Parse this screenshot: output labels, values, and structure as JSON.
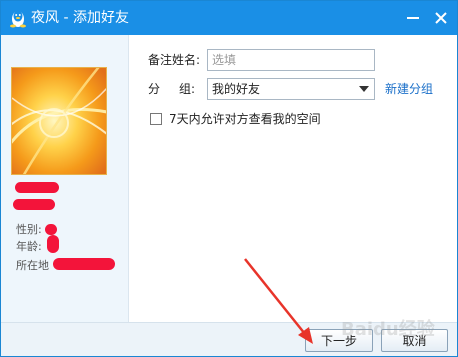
{
  "window": {
    "title": "夜风 - 添加好友",
    "title_bar_color": "#1a8fe6"
  },
  "icons": {
    "app": "qq-penguin-icon",
    "minimize": "minimize-icon",
    "close": "close-icon",
    "dropdown": "dropdown-arrow-icon"
  },
  "profile": {
    "gender_label": "性别:",
    "age_label": "年龄:",
    "location_label": "所在地"
  },
  "form": {
    "remark_label": "备注姓名:",
    "remark_value": "",
    "remark_placeholder": "选填",
    "group_label_part1": "分",
    "group_label_part2": "组:",
    "group_value": "我的好友",
    "new_group_link": "新建分组",
    "allow_view_label": "7天内允许对方查看我的空间",
    "allow_view_checked": false
  },
  "buttons": {
    "next": "下一步",
    "cancel": "取消"
  },
  "watermark": "Baidu经验",
  "colors": {
    "accent": "#1a8fe6",
    "link": "#1a6fc9",
    "redaction": "#f3143a",
    "annotation_arrow": "#e8342a"
  }
}
